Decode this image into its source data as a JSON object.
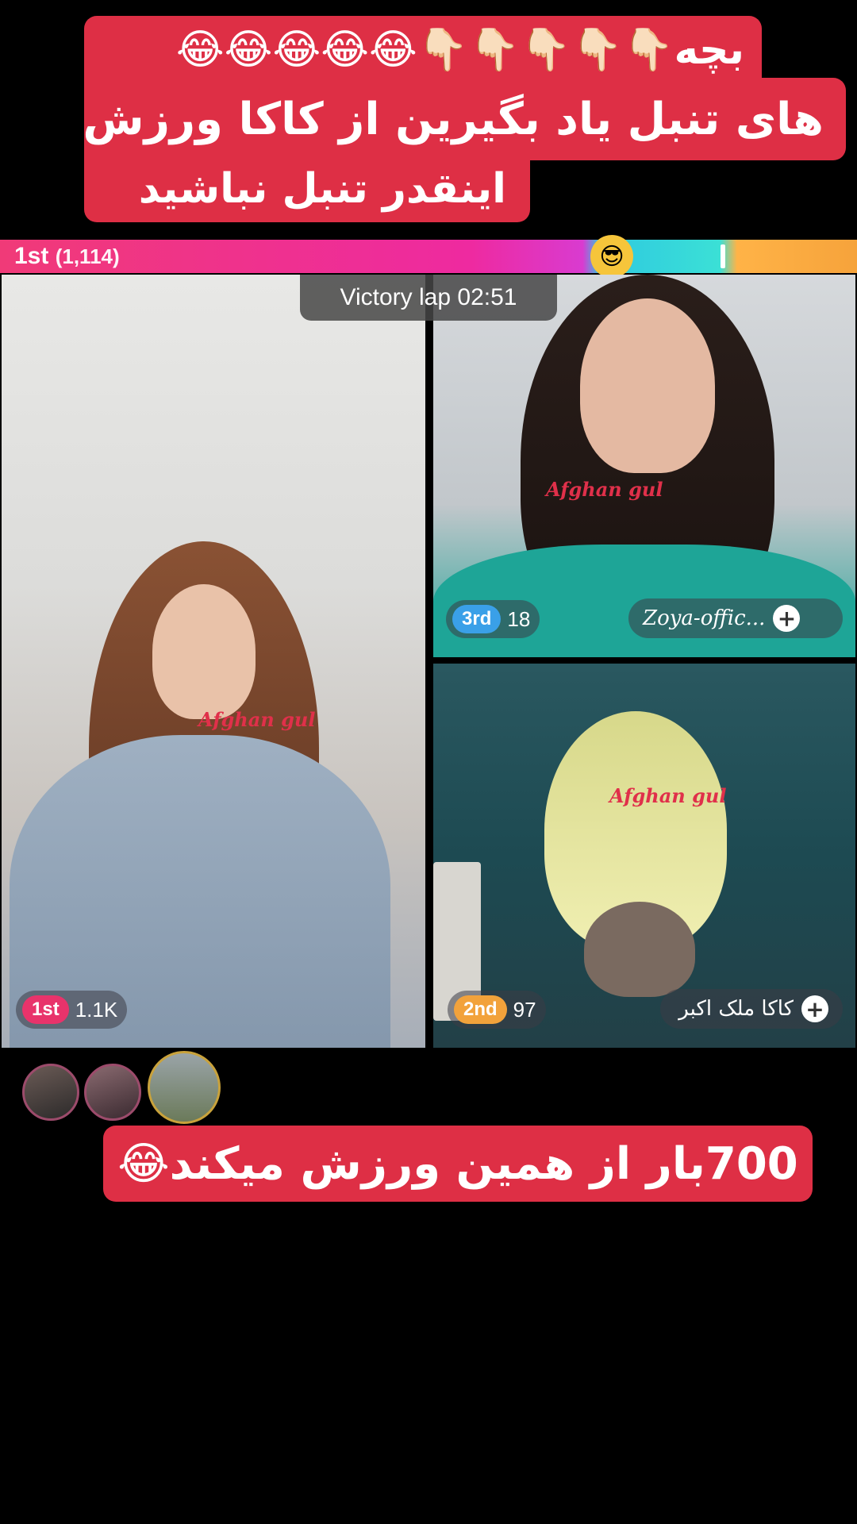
{
  "caption_top": {
    "line1": "بچه👇🏻👇🏻👇🏻👇🏻👇🏻😂😂😂😂😂",
    "line2": "های تنبل یاد بگیرین از کاکا ورزش",
    "line3": "اینقدر تنبل نباشید"
  },
  "battle_bar": {
    "leader_label": "1st",
    "leader_score": "(1,114)",
    "emoji": "😎"
  },
  "timer": {
    "text": "Victory lap  02:51"
  },
  "panels": {
    "left": {
      "rank": "1st",
      "score": "1.1K",
      "rank_color": "#e8336b",
      "watermark": "Afghan gul"
    },
    "top_right": {
      "rank": "3rd",
      "score": "18",
      "rank_color": "#3aa0e8",
      "name": "Zoya-offic...",
      "watermark": "Afghan gul"
    },
    "bottom_right": {
      "rank": "2nd",
      "score": "97",
      "rank_color": "#f2a23b",
      "name": "کاکا ملک اکبر",
      "watermark": "Afghan gul"
    }
  },
  "add_icon": "+",
  "caption_bottom": {
    "text": "700بار از همین ورزش میکند😂"
  },
  "colors": {
    "caption_bg": "#de2f45",
    "background": "#000000"
  }
}
